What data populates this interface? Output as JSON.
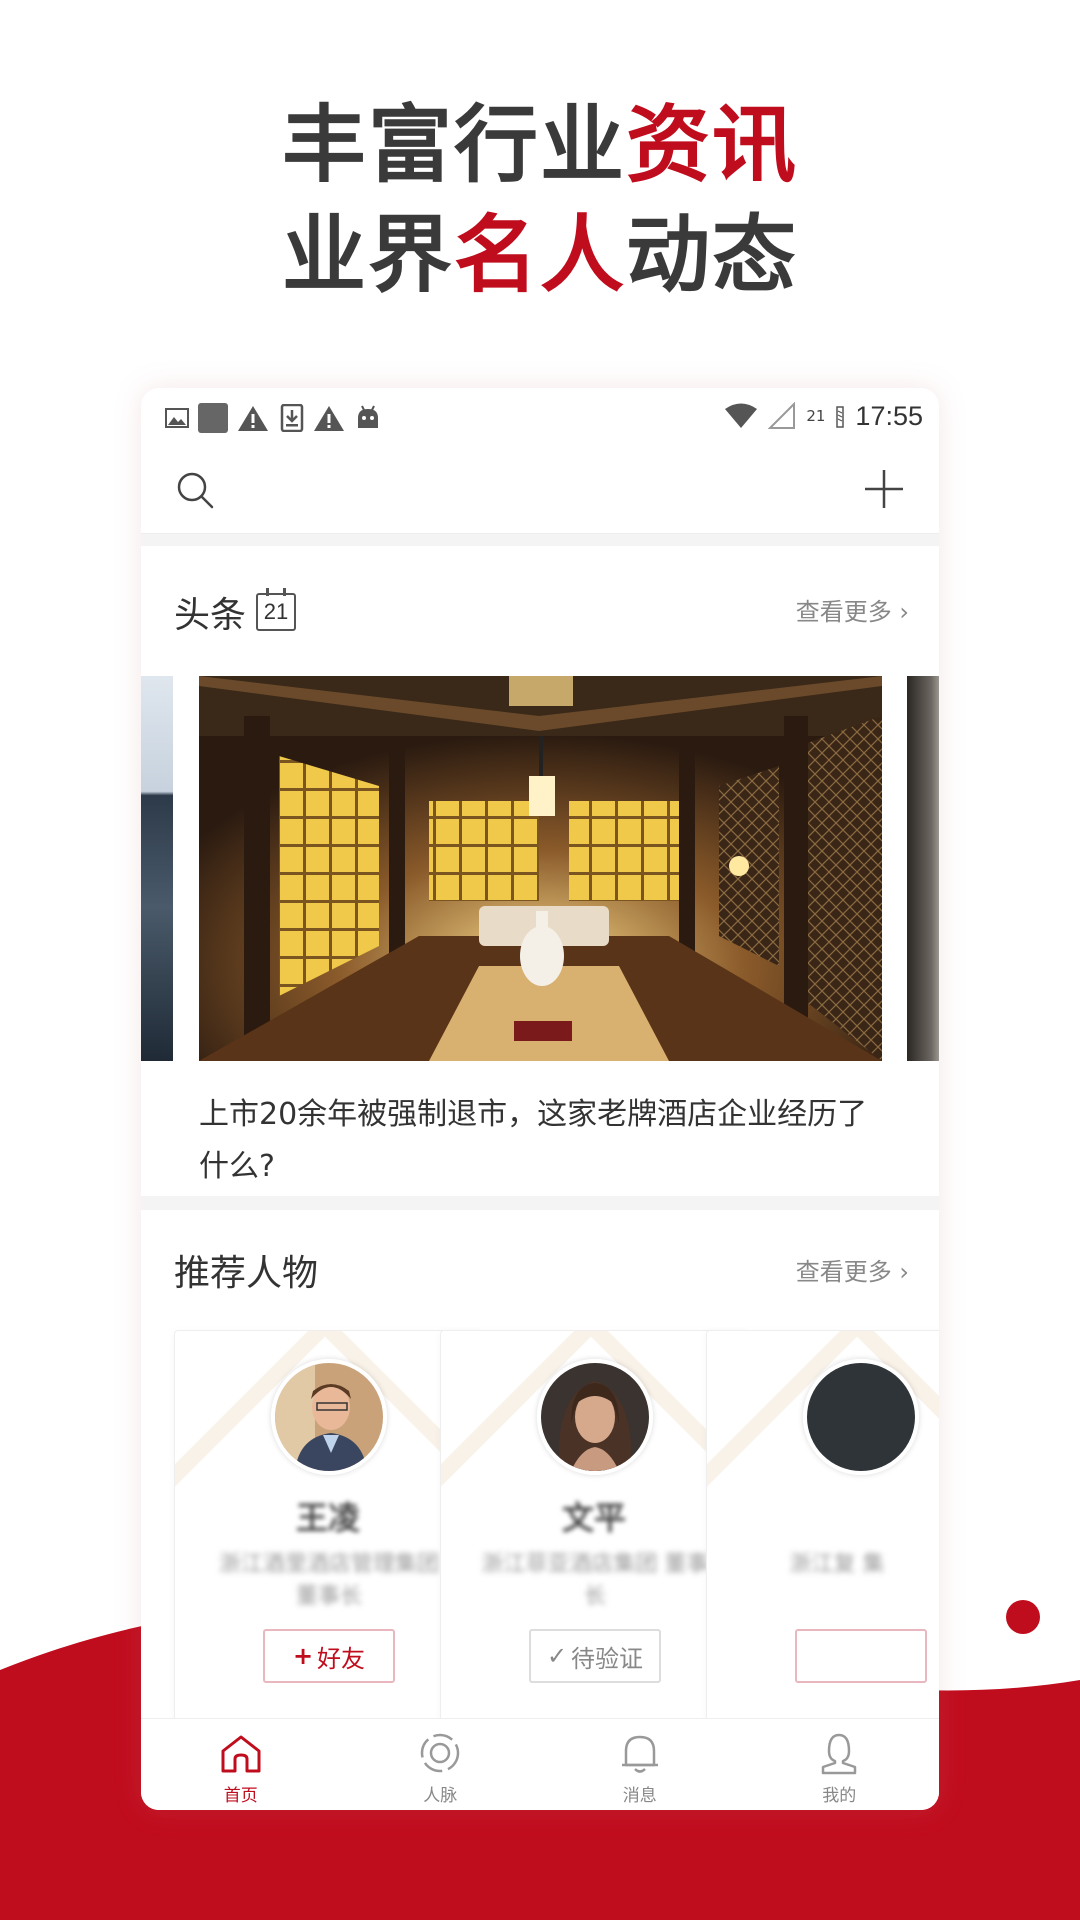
{
  "promo": {
    "line1_plain": "丰富行业",
    "line1_red": "资讯",
    "line2_plain_a": "业界",
    "line2_red": "名人",
    "line2_plain_b": "动态"
  },
  "statusbar": {
    "time": "17:55",
    "battery": "21",
    "left_icons": [
      "image-icon",
      "square-icon",
      "warning-icon",
      "download-icon",
      "warning-icon",
      "android-icon"
    ]
  },
  "topbar": {
    "search_icon": "search-icon",
    "add_icon": "plus-icon"
  },
  "headlines": {
    "title": "头条",
    "date_badge": "21",
    "more": "查看更多",
    "news_title": "上市20余年被强制退市，这家老牌酒店企业经历了什么?"
  },
  "people": {
    "title": "推荐人物",
    "more": "查看更多",
    "cards": [
      {
        "name": "王凌",
        "desc": "浙江酒里酒店管理集团 董事长",
        "button_icon": "+",
        "button_label": "好友"
      },
      {
        "name": "文平",
        "desc": "浙江菲亚酒店集团 董事长",
        "button_icon": "✓",
        "button_label": "待验证"
      },
      {
        "name": "",
        "desc": "浙江复 集",
        "button_icon": "",
        "button_label": ""
      }
    ]
  },
  "tabs": [
    {
      "label": "首页",
      "icon": "home-icon",
      "active": true
    },
    {
      "label": "人脉",
      "icon": "network-icon",
      "active": false
    },
    {
      "label": "消息",
      "icon": "bell-icon",
      "active": false
    },
    {
      "label": "我的",
      "icon": "profile-icon",
      "active": false
    }
  ],
  "colors": {
    "brand_red": "#c00d1e",
    "text_dark": "#333333",
    "text_muted": "#888888"
  }
}
